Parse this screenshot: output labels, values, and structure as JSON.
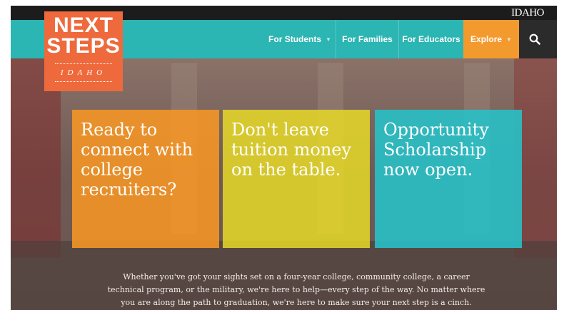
{
  "header": {
    "state_logo": "IDAHO"
  },
  "logo": {
    "line1": "NEXT",
    "line2": "STEPS",
    "line3": "IDAHO"
  },
  "nav": {
    "items": [
      {
        "label": "For Students",
        "has_dropdown": true
      },
      {
        "label": "For Families",
        "has_dropdown": false
      },
      {
        "label": "For Educators",
        "has_dropdown": false
      },
      {
        "label": "Explore",
        "has_dropdown": true
      }
    ],
    "search_icon": "search-icon"
  },
  "cards": [
    {
      "text": "Ready to connect with college recruiters?",
      "color": "#f79624"
    },
    {
      "text": "Don't leave tuition money on the table.",
      "color": "#e2d628"
    },
    {
      "text": "Opportunity Scholarship now open.",
      "color": "#26c3c9"
    }
  ],
  "tagline": "Whether you've got your sights set on a four-year college, community college, a career technical program, or the military, we're here to help—every step of the way. No matter where you are along the path to graduation, we're here to make sure your next step is a cinch.",
  "colors": {
    "nav_teal": "#2bb5b3",
    "explore_orange": "#f39a2f",
    "logo_orange": "#ee6a3c",
    "top_bar": "#1c1c1c"
  }
}
